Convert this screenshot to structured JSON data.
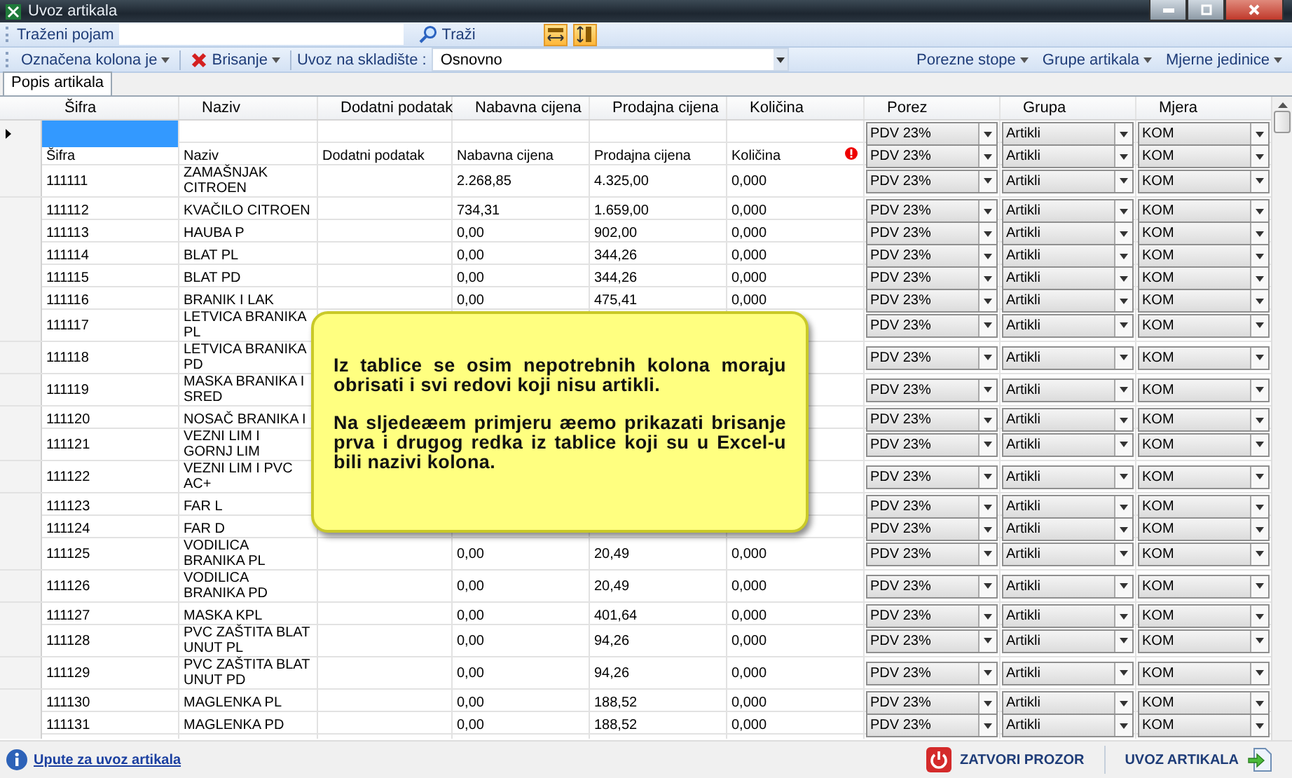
{
  "window": {
    "title": "Uvoz artikala"
  },
  "search_toolbar": {
    "label": "Traženi pojam",
    "button": "Traži"
  },
  "action_toolbar": {
    "marked_column": "Označena kolona je",
    "delete": "Brisanje",
    "warehouse_label": "Uvoz na skladište :",
    "warehouse": "Osnovno",
    "right_menus": [
      "Porezne stope",
      "Grupe artikala",
      "Mjerne jedinice"
    ]
  },
  "tabs": [
    {
      "label": "Popis artikala",
      "selected": true
    }
  ],
  "table": {
    "columns": [
      "Šifra",
      "Naziv",
      "Dodatni podatak",
      "Nabavna cijena",
      "Prodajna cijena",
      "Količina",
      "Porez",
      "Grupa",
      "Mjera"
    ],
    "rows": [
      {
        "current": true,
        "error": false,
        "porez": "PDV 23%",
        "grupa": "Artikli",
        "mjera": "KOM"
      },
      {
        "current": false,
        "error": true,
        "sifra": "Šifra",
        "naziv": "Naziv",
        "dodatni": "Dodatni podatak",
        "nabavna": "Nabavna cijena",
        "prodajna": "Prodajna cijena",
        "kolicina": "Količina",
        "porez": "PDV 23%",
        "grupa": "Artikli",
        "mjera": "KOM"
      },
      {
        "current": false,
        "error": false,
        "sifra": "111111",
        "naziv": "ZAMAŠNJAK CITROEN",
        "nabavna": "2.268,85",
        "prodajna": "4.325,00",
        "kolicina": "0,000",
        "porez": "PDV 23%",
        "grupa": "Artikli",
        "mjera": "KOM"
      },
      {
        "current": false,
        "error": false,
        "sifra": "111112",
        "naziv": "KVAČILO CITROEN",
        "nabavna": "734,31",
        "prodajna": "1.659,00",
        "kolicina": "0,000",
        "porez": "PDV 23%",
        "grupa": "Artikli",
        "mjera": "KOM"
      },
      {
        "current": false,
        "error": false,
        "sifra": "111113",
        "naziv": "HAUBA P",
        "nabavna": "0,00",
        "prodajna": "902,00",
        "kolicina": "0,000",
        "porez": "PDV 23%",
        "grupa": "Artikli",
        "mjera": "KOM"
      },
      {
        "current": false,
        "error": false,
        "sifra": "111114",
        "naziv": "BLAT PL",
        "nabavna": "0,00",
        "prodajna": "344,26",
        "kolicina": "0,000",
        "porez": "PDV 23%",
        "grupa": "Artikli",
        "mjera": "KOM"
      },
      {
        "current": false,
        "error": false,
        "sifra": "111115",
        "naziv": "BLAT PD",
        "nabavna": "0,00",
        "prodajna": "344,26",
        "kolicina": "0,000",
        "porez": "PDV 23%",
        "grupa": "Artikli",
        "mjera": "KOM"
      },
      {
        "current": false,
        "error": false,
        "sifra": "111116",
        "naziv": "BRANIK I LAK",
        "nabavna": "0,00",
        "prodajna": "475,41",
        "kolicina": "0,000",
        "porez": "PDV 23%",
        "grupa": "Artikli",
        "mjera": "KOM"
      },
      {
        "current": false,
        "error": false,
        "sifra": "111117",
        "naziv": "LETVICA BRANIKA PL",
        "porez": "PDV 23%",
        "grupa": "Artikli",
        "mjera": "KOM"
      },
      {
        "current": false,
        "error": false,
        "sifra": "111118",
        "naziv": "LETVICA BRANIKA PD",
        "porez": "PDV 23%",
        "grupa": "Artikli",
        "mjera": "KOM"
      },
      {
        "current": false,
        "error": false,
        "sifra": "111119",
        "naziv": "MASKA BRANIKA I SRED",
        "porez": "PDV 23%",
        "grupa": "Artikli",
        "mjera": "KOM"
      },
      {
        "current": false,
        "error": false,
        "sifra": "111120",
        "naziv": "NOSAČ BRANIKA I",
        "porez": "PDV 23%",
        "grupa": "Artikli",
        "mjera": "KOM"
      },
      {
        "current": false,
        "error": false,
        "sifra": "111121",
        "naziv": "VEZNI LIM I GORNJ LIM",
        "porez": "PDV 23%",
        "grupa": "Artikli",
        "mjera": "KOM"
      },
      {
        "current": false,
        "error": false,
        "sifra": "111122",
        "naziv": "VEZNI LIM I PVC AC+",
        "porez": "PDV 23%",
        "grupa": "Artikli",
        "mjera": "KOM"
      },
      {
        "current": false,
        "error": false,
        "sifra": "111123",
        "naziv": "FAR L",
        "porez": "PDV 23%",
        "grupa": "Artikli",
        "mjera": "KOM"
      },
      {
        "current": false,
        "error": false,
        "sifra": "111124",
        "naziv": "FAR D",
        "porez": "PDV 23%",
        "grupa": "Artikli",
        "mjera": "KOM"
      },
      {
        "current": false,
        "error": false,
        "sifra": "111125",
        "naziv": "VODILICA BRANIKA PL",
        "nabavna": "0,00",
        "prodajna": "20,49",
        "kolicina": "0,000",
        "porez": "PDV 23%",
        "grupa": "Artikli",
        "mjera": "KOM"
      },
      {
        "current": false,
        "error": false,
        "sifra": "111126",
        "naziv": "VODILICA BRANIKA PD",
        "nabavna": "0,00",
        "prodajna": "20,49",
        "kolicina": "0,000",
        "porez": "PDV 23%",
        "grupa": "Artikli",
        "mjera": "KOM"
      },
      {
        "current": false,
        "error": false,
        "sifra": "111127",
        "naziv": "MASKA KPL",
        "nabavna": "0,00",
        "prodajna": "401,64",
        "kolicina": "0,000",
        "porez": "PDV 23%",
        "grupa": "Artikli",
        "mjera": "KOM"
      },
      {
        "current": false,
        "error": false,
        "sifra": "111128",
        "naziv": "PVC ZAŠTITA BLAT UNUT PL",
        "nabavna": "0,00",
        "prodajna": "94,26",
        "kolicina": "0,000",
        "porez": "PDV 23%",
        "grupa": "Artikli",
        "mjera": "KOM"
      },
      {
        "current": false,
        "error": false,
        "sifra": "111129",
        "naziv": "PVC ZAŠTITA BLAT UNUT PD",
        "nabavna": "0,00",
        "prodajna": "94,26",
        "kolicina": "0,000",
        "porez": "PDV 23%",
        "grupa": "Artikli",
        "mjera": "KOM"
      },
      {
        "current": false,
        "error": false,
        "sifra": "111130",
        "naziv": "MAGLENKA PL",
        "nabavna": "0,00",
        "prodajna": "188,52",
        "kolicina": "0,000",
        "porez": "PDV 23%",
        "grupa": "Artikli",
        "mjera": "KOM"
      },
      {
        "current": false,
        "error": false,
        "sifra": "111131",
        "naziv": "MAGLENKA PD",
        "nabavna": "0,00",
        "prodajna": "188,52",
        "kolicina": "0,000",
        "porez": "PDV 23%",
        "grupa": "Artikli",
        "mjera": "KOM"
      }
    ]
  },
  "callout": {
    "paragraphs": [
      "Iz tablice se osim nepotrebnih kolona moraju obrisati i svi redovi koji nisu artikli.",
      "Na sljedeæem primjeru æemo prikazati brisanje prva i drugog redka iz tablice koji su u Excel-u bili nazivi kolona."
    ]
  },
  "footer": {
    "help_link": "Upute za uvoz artikala",
    "close_button": "ZATVORI PROZOR",
    "import_button": "UVOZ ARTIKALA"
  }
}
